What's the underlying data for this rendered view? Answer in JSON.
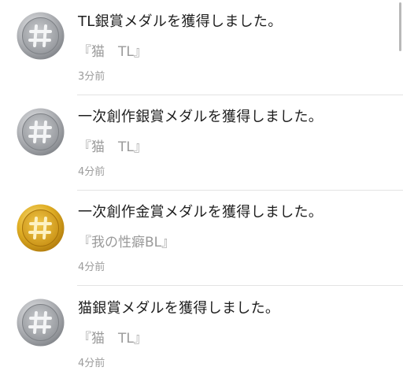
{
  "notifications": [
    {
      "medal": "silver-medal-icon",
      "title": "TL銀賞メダルを獲得しました。",
      "subtitle": "『猫　TL』",
      "time": "3分前"
    },
    {
      "medal": "silver-medal-icon",
      "title": "一次創作銀賞メダルを獲得しました。",
      "subtitle": "『猫　TL』",
      "time": "4分前"
    },
    {
      "medal": "gold-medal-icon",
      "title": "一次創作金賞メダルを獲得しました。",
      "subtitle": "『我の性癖BL』",
      "time": "4分前"
    },
    {
      "medal": "silver-medal-icon",
      "title": "猫銀賞メダルを獲得しました。",
      "subtitle": "『猫　TL』",
      "time": "4分前"
    }
  ],
  "colors": {
    "silver": "#9ea1a6",
    "gold": "#d9a91c",
    "divider": "#e3e3e3",
    "text": "#1e1e1e",
    "muted": "#9a9a9a"
  }
}
